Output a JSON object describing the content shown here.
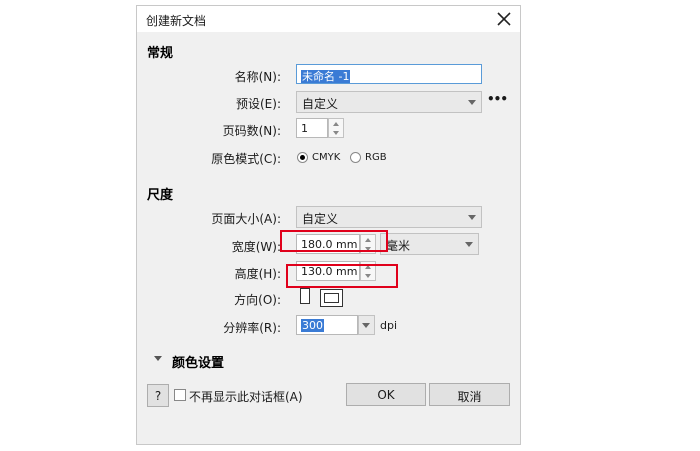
{
  "dialog": {
    "title": "创建新文档",
    "close_icon": "close-icon"
  },
  "general": {
    "heading": "常规",
    "name_label": "名称(N):",
    "name_value": "未命名 -1",
    "preset_label": "预设(E):",
    "preset_value": "自定义",
    "more_label": "•••",
    "pages_label": "页码数(N):",
    "pages_value": "1",
    "color_mode_label": "原色模式(C):",
    "color_mode_options": [
      "CMYK",
      "RGB"
    ],
    "color_mode_selected": "CMYK"
  },
  "dimensions": {
    "heading": "尺度",
    "page_size_label": "页面大小(A):",
    "page_size_value": "自定义",
    "width_label": "宽度(W):",
    "width_value": "180.0 mm",
    "unit_value": "毫米",
    "height_label": "高度(H):",
    "height_value": "130.0 mm",
    "orientation_label": "方向(O):",
    "resolution_label": "分辨率(R):",
    "resolution_value": "300",
    "resolution_unit": "dpi"
  },
  "color_settings": {
    "heading": "颜色设置"
  },
  "footer": {
    "help_label": "?",
    "dont_show_label": "不再显示此对话框(A)",
    "ok_label": "OK",
    "cancel_label": "取消"
  },
  "colors": {
    "highlight_box": "#e0001b",
    "selection": "#3a7bd5"
  }
}
